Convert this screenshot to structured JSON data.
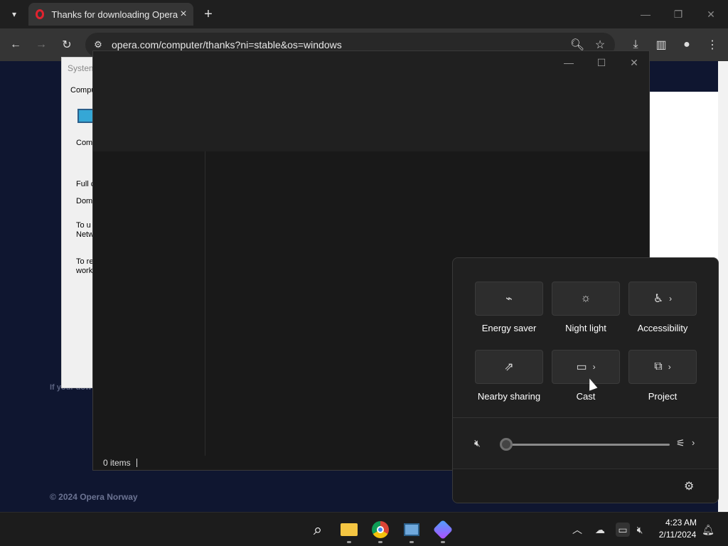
{
  "browser": {
    "tab_title": "Thanks for downloading Opera",
    "url": "opera.com/computer/thanks?ni=stable&os=windows"
  },
  "page": {
    "footer": "© 2024 Opera Norway",
    "hint": "If your dow"
  },
  "system_properties": {
    "title": "System",
    "tab": "Compu",
    "lines": [
      "Comp",
      "Full c",
      "Doma",
      "To u",
      "Netw",
      "To re",
      "work"
    ]
  },
  "explorer": {
    "status": "0 items"
  },
  "quick_settings": {
    "tiles": [
      {
        "label": "Energy saver",
        "icon": "energy-saver-icon",
        "has_chevron": false
      },
      {
        "label": "Night light",
        "icon": "night-light-icon",
        "has_chevron": false
      },
      {
        "label": "Accessibility",
        "icon": "accessibility-icon",
        "has_chevron": true
      },
      {
        "label": "Nearby sharing",
        "icon": "share-icon",
        "has_chevron": false
      },
      {
        "label": "Cast",
        "icon": "cast-icon",
        "has_chevron": true
      },
      {
        "label": "Project",
        "icon": "project-icon",
        "has_chevron": true
      }
    ],
    "volume": 0
  },
  "taskbar": {
    "time": "4:23 AM",
    "date": "2/11/2024"
  }
}
